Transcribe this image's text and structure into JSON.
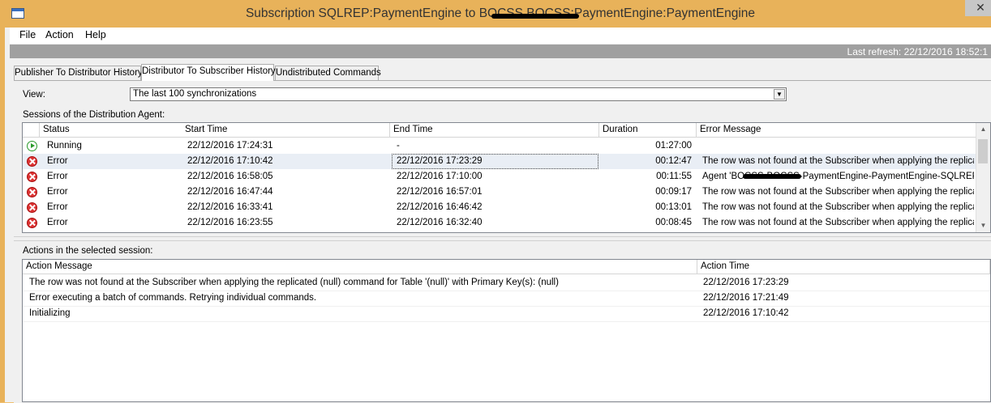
{
  "window": {
    "title": "Subscription SQLREP:PaymentEngine to BOCSS.BOCSS:PaymentEngine:PaymentEngine",
    "close_glyph": "✕"
  },
  "menu": [
    "File",
    "Action",
    "Help"
  ],
  "refresh": {
    "text": "Last refresh: 22/12/2016 18:52:1"
  },
  "tabs": [
    {
      "label": "Publisher To Distributor History",
      "active": false
    },
    {
      "label": "Distributor To Subscriber History",
      "active": true
    },
    {
      "label": "Undistributed Commands",
      "active": false
    }
  ],
  "view": {
    "label": "View:",
    "value": "The last 100 synchronizations"
  },
  "sessions": {
    "label": "Sessions of the Distribution Agent:",
    "columns": [
      "Status",
      "Start Time",
      "End Time",
      "Duration",
      "Error Message"
    ],
    "rows": [
      {
        "icon": "running-icon",
        "status": "Running",
        "start": "22/12/2016 17:24:31",
        "end": "-",
        "duration": "01:27:00",
        "message": ""
      },
      {
        "icon": "error-icon",
        "status": "Error",
        "start": "22/12/2016 17:10:42",
        "end": "22/12/2016 17:23:29",
        "duration": "00:12:47",
        "message": "The row was not found at the Subscriber when applying the replicat..."
      },
      {
        "icon": "error-icon",
        "status": "Error",
        "start": "22/12/2016 16:58:05",
        "end": "22/12/2016 17:10:00",
        "duration": "00:11:55",
        "message": "Agent 'BOCSS-BOCSS-PaymentEngine-PaymentEngine-SQLREP-..."
      },
      {
        "icon": "error-icon",
        "status": "Error",
        "start": "22/12/2016 16:47:44",
        "end": "22/12/2016 16:57:01",
        "duration": "00:09:17",
        "message": "The row was not found at the Subscriber when applying the replicat..."
      },
      {
        "icon": "error-icon",
        "status": "Error",
        "start": "22/12/2016 16:33:41",
        "end": "22/12/2016 16:46:42",
        "duration": "00:13:01",
        "message": "The row was not found at the Subscriber when applying the replicat..."
      },
      {
        "icon": "error-icon",
        "status": "Error",
        "start": "22/12/2016 16:23:55",
        "end": "22/12/2016 16:32:40",
        "duration": "00:08:45",
        "message": "The row was not found at the Subscriber when applying the replicat..."
      }
    ]
  },
  "actions": {
    "label": "Actions in the selected session:",
    "columns": [
      "Action Message",
      "Action Time"
    ],
    "rows": [
      {
        "message": "The row was not found at the Subscriber when applying the replicated (null) command for Table '(null)' with Primary Key(s): (null)",
        "time": "22/12/2016 17:23:29"
      },
      {
        "message": "Error executing a batch of commands. Retrying individual commands.",
        "time": "22/12/2016 17:21:49"
      },
      {
        "message": "Initializing",
        "time": "22/12/2016 17:10:42"
      }
    ]
  }
}
